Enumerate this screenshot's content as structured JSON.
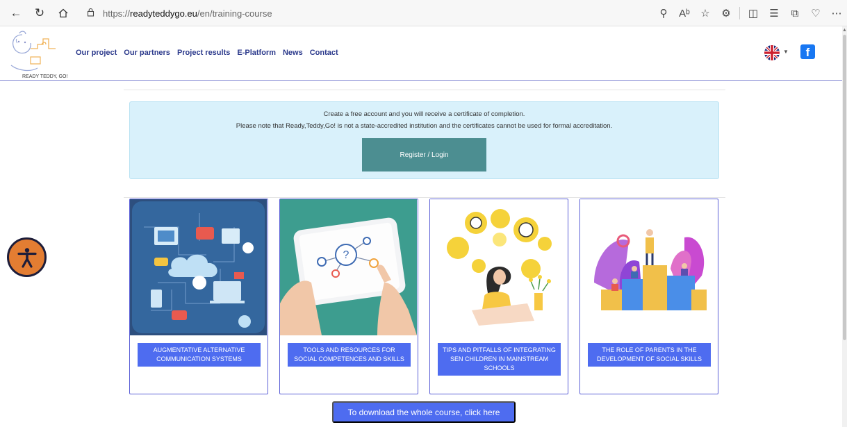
{
  "browser": {
    "url_prefix": "https://",
    "url_host": "readyteddygo.eu",
    "url_path": "/en/training-course"
  },
  "logo": {
    "text": "READY TEDDY, GO!"
  },
  "nav": {
    "items": [
      {
        "label": "Our project"
      },
      {
        "label": "Our partners"
      },
      {
        "label": "Project results"
      },
      {
        "label": "E-Platform"
      },
      {
        "label": "News"
      },
      {
        "label": "Contact"
      }
    ]
  },
  "info": {
    "line1": "Create a free account and you will receive a certificate of completion.",
    "line2": "Please note that Ready,Teddy,Go! is not a state-accredited institution and the certificates cannot be used for formal accreditation.",
    "register_label": "Register / Login"
  },
  "cards": [
    {
      "label": "AUGMENTATIVE ALTERNATIVE COMMUNICATION SYSTEMS"
    },
    {
      "label": "TOOLS AND RESOURCES FOR SOCIAL COMPETENCES AND SKILLS"
    },
    {
      "label": "TIPS AND PITFALLS OF INTEGRATING SEN CHILDREN IN MAINSTREAM SCHOOLS"
    },
    {
      "label": "THE ROLE OF PARENTS IN THE DEVELOPMENT OF SOCIAL SKILLS"
    }
  ],
  "download": {
    "label": "To download the whole course, click here"
  },
  "colors": {
    "nav": "#2c3a8c",
    "accent": "#4e6cf0",
    "register": "#4c8e91",
    "info_bg": "#d9f1fb",
    "a11y": "#e37d32"
  }
}
